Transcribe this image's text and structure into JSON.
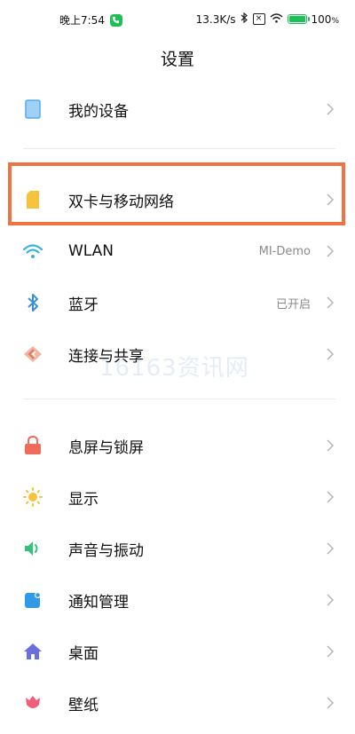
{
  "status_bar": {
    "time": "晚上7:54",
    "speed": "13.3K/s",
    "battery": "100",
    "battery_unit": "%"
  },
  "page": {
    "title": "设置"
  },
  "items": [
    {
      "label": "我的设备",
      "value": "",
      "icon": "device-icon",
      "color": "#5aa9e6"
    },
    {
      "label": "双卡与移动网络",
      "value": "",
      "icon": "sim-card-icon",
      "color": "#f6c33c"
    },
    {
      "label": "WLAN",
      "value": "MI-Demo",
      "icon": "wifi-icon",
      "color": "#3ab3d8"
    },
    {
      "label": "蓝牙",
      "value": "已开启",
      "icon": "bluetooth-icon",
      "color": "#3a8fd8"
    },
    {
      "label": "连接与共享",
      "value": "",
      "icon": "connection-icon",
      "color": "#e07a5f"
    },
    {
      "label": "息屏与锁屏",
      "value": "",
      "icon": "lock-icon",
      "color": "#ef6b5b"
    },
    {
      "label": "显示",
      "value": "",
      "icon": "sun-icon",
      "color": "#f6c33c"
    },
    {
      "label": "声音与振动",
      "value": "",
      "icon": "speaker-icon",
      "color": "#33c27a"
    },
    {
      "label": "通知管理",
      "value": "",
      "icon": "notification-icon",
      "color": "#2f9be8"
    },
    {
      "label": "桌面",
      "value": "",
      "icon": "home-icon",
      "color": "#6c6ee0"
    },
    {
      "label": "壁纸",
      "value": "",
      "icon": "tulip-icon",
      "color": "#ef5f7a"
    }
  ],
  "watermark": "16163资讯网"
}
